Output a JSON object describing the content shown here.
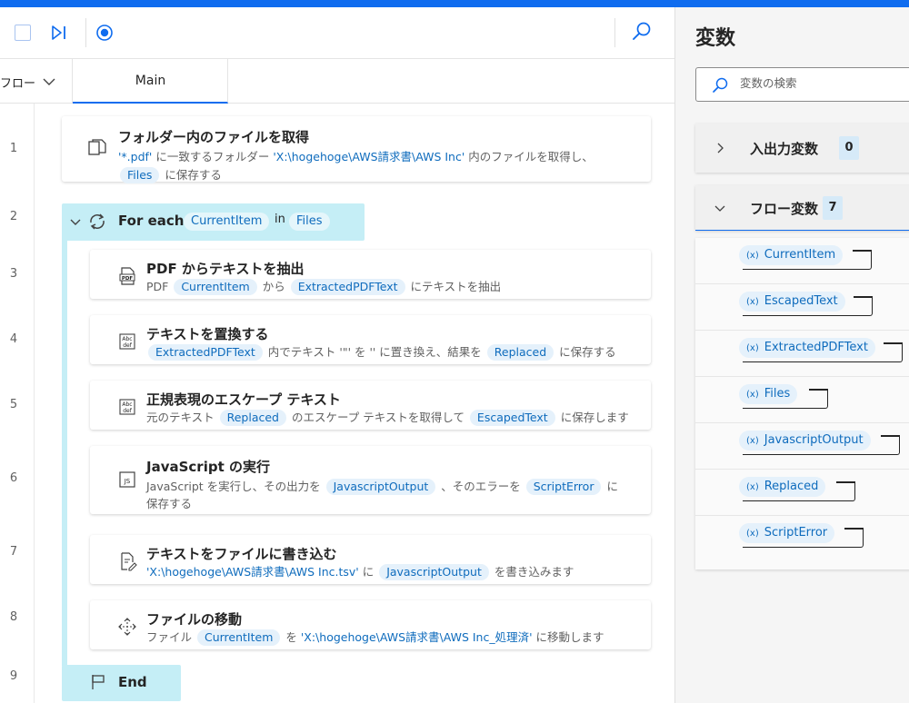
{
  "toolbar": {
    "stop_icon": "stop-icon",
    "step_icon": "step-next-icon",
    "record_icon": "record-icon",
    "search_icon": "search-icon"
  },
  "tabs": {
    "subflows_label": "フロー",
    "main_label": "Main"
  },
  "line_numbers": [
    "1",
    "2",
    "3",
    "4",
    "5",
    "6",
    "7",
    "8",
    "9"
  ],
  "actions": {
    "a1": {
      "title": "フォルダー内のファイルを取得",
      "d1": "'*.pdf'",
      "d2": " に一致するフォルダー ",
      "d3": "'X:\\hogehoge\\AWS請求書\\AWS Inc'",
      "d4": " 内のファイルを取得し、",
      "d5": "Files",
      "d6": " に保存する"
    },
    "foreach": {
      "title": "For each",
      "item": "CurrentItem",
      "in": "in",
      "list": "Files"
    },
    "a3": {
      "title": "PDF からテキストを抽出",
      "d1": "PDF ",
      "d2": "CurrentItem",
      "d3": " から ",
      "d4": "ExtractedPDFText",
      "d5": " にテキストを抽出"
    },
    "a4": {
      "title": "テキストを置換する",
      "d1": "ExtractedPDFText",
      "d2": " 内でテキスト '\"' を '' に置き換え、結果を ",
      "d3": "Replaced",
      "d4": " に保存する"
    },
    "a5": {
      "title": "正規表現のエスケープ テキスト",
      "d1": "元のテキスト ",
      "d2": "Replaced",
      "d3": " のエスケープ テキストを取得して ",
      "d4": "EscapedText",
      "d5": " に保存します"
    },
    "a6": {
      "title": "JavaScript の実行",
      "d1": "JavaScript を実行し、その出力を ",
      "d2": "JavascriptOutput",
      "d3": " 、そのエラーを ",
      "d4": "ScriptError",
      "d5": " に",
      "d6": "保存する"
    },
    "a7": {
      "title": "テキストをファイルに書き込む",
      "d1": "'X:\\hogehoge\\AWS請求書\\AWS Inc.tsv'",
      "d2": " に ",
      "d3": "JavascriptOutput",
      "d4": " を書き込みます"
    },
    "a8": {
      "title": "ファイルの移動",
      "d1": "ファイル ",
      "d2": "CurrentItem",
      "d3": " を ",
      "d4": "'X:\\hogehoge\\AWS請求書\\AWS Inc_処理済'",
      "d5": " に移動します"
    },
    "end": {
      "title": "End"
    }
  },
  "variables_pane": {
    "title": "変数",
    "search_placeholder": "変数の検索",
    "io_section": {
      "label": "入出力変数",
      "count": "0"
    },
    "flow_section": {
      "label": "フロー変数",
      "count": "7"
    },
    "flow_vars": [
      {
        "x": "(x)",
        "name": "CurrentItem"
      },
      {
        "x": "(x)",
        "name": "EscapedText"
      },
      {
        "x": "(x)",
        "name": "ExtractedPDFText"
      },
      {
        "x": "(x)",
        "name": "Files"
      },
      {
        "x": "(x)",
        "name": "JavascriptOutput"
      },
      {
        "x": "(x)",
        "name": "Replaced"
      },
      {
        "x": "(x)",
        "name": "ScriptError"
      }
    ]
  },
  "colors": {
    "accent": "#0f6cef",
    "chip_bg": "#e5f1fb",
    "chip_text": "#0f6cbd",
    "loop_bg": "#c5eef6"
  }
}
